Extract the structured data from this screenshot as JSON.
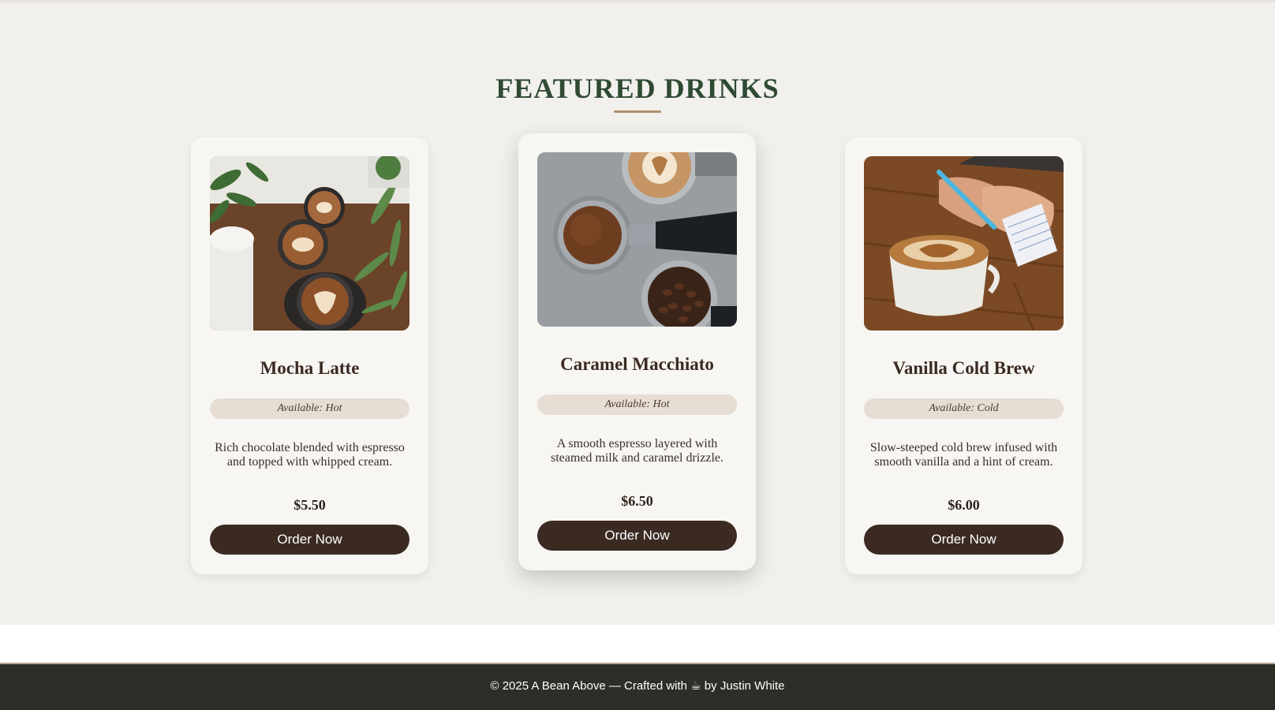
{
  "section": {
    "title": "FEATURED DRINKS"
  },
  "drinks": [
    {
      "name": "Mocha Latte",
      "availability": "Available: Hot",
      "description": "Rich chocolate blended with espresso and topped with whipped cream.",
      "price": "$5.50",
      "button_label": "Order Now",
      "image": "latte-cups-photo"
    },
    {
      "name": "Caramel Macchiato",
      "availability": "Available: Hot",
      "description": "A smooth espresso layered with steamed milk and caramel drizzle.",
      "price": "$6.50",
      "button_label": "Order Now",
      "image": "espresso-portafilter-photo"
    },
    {
      "name": "Vanilla Cold Brew",
      "availability": "Available: Cold",
      "description": "Slow-steeped cold brew infused with smooth vanilla and a hint of cream.",
      "price": "$6.00",
      "button_label": "Order Now",
      "image": "coffee-and-notebook-photo"
    }
  ],
  "footer": {
    "text": "© 2025 A Bean Above — Crafted with ☕ by Justin White"
  },
  "colors": {
    "accent_green": "#2f4a33",
    "button_brown": "#3a2a22",
    "badge_bg": "#e6ddd4",
    "underline_tan": "#b08f6c",
    "footer_bg": "#2b2f28"
  }
}
